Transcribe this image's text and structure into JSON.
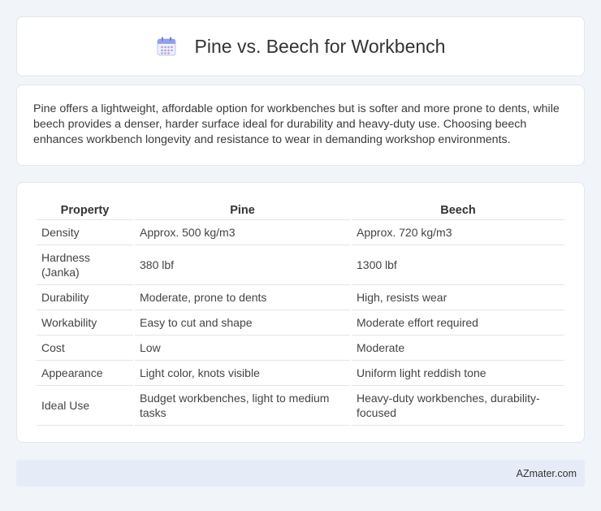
{
  "header": {
    "title": "Pine vs. Beech for Workbench",
    "icon": "calendar-icon",
    "icon_color": "#7b8fd6"
  },
  "intro": {
    "text": "Pine offers a lightweight, affordable option for workbenches but is softer and more prone to dents, while beech provides a denser, harder surface ideal for durability and heavy-duty use. Choosing beech enhances workbench longevity and resistance to wear in demanding workshop environments."
  },
  "table": {
    "headers": [
      "Property",
      "Pine",
      "Beech"
    ],
    "rows": [
      [
        "Density",
        "Approx. 500 kg/m3",
        "Approx. 720 kg/m3"
      ],
      [
        "Hardness (Janka)",
        "380 lbf",
        "1300 lbf"
      ],
      [
        "Durability",
        "Moderate, prone to dents",
        "High, resists wear"
      ],
      [
        "Workability",
        "Easy to cut and shape",
        "Moderate effort required"
      ],
      [
        "Cost",
        "Low",
        "Moderate"
      ],
      [
        "Appearance",
        "Light color, knots visible",
        "Uniform light reddish tone"
      ],
      [
        "Ideal Use",
        "Budget workbenches, light to medium tasks",
        "Heavy-duty workbenches, durability-focused"
      ]
    ]
  },
  "footer": {
    "brand": "AZmater.com"
  },
  "colors": {
    "background": "#f1f4f9",
    "card": "#ffffff",
    "footer_bg": "#e6ecf7"
  }
}
